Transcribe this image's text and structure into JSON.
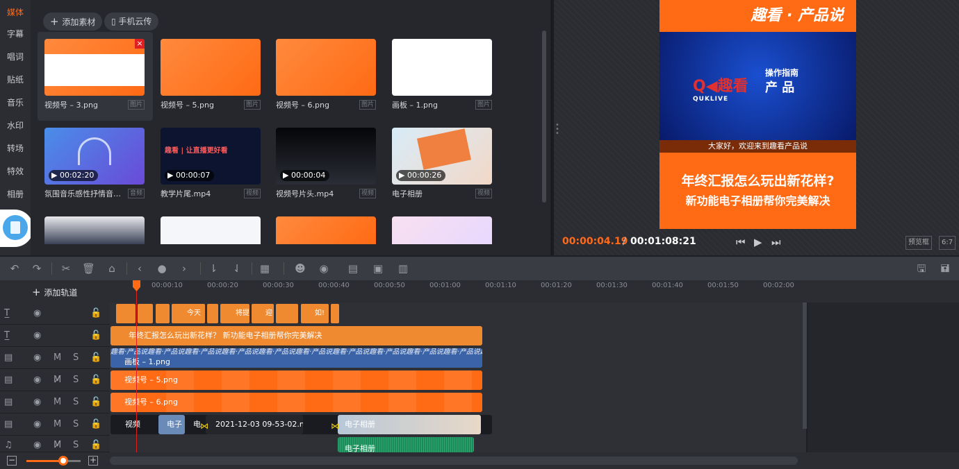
{
  "nav": [
    "媒体",
    "字幕",
    "唱词",
    "贴纸",
    "音乐",
    "水印",
    "转场",
    "特效",
    "相册"
  ],
  "media": {
    "add_label": "添加素材",
    "phone_label": "手机云传",
    "cards": [
      {
        "name": "视频号 – 3.png",
        "tag": "图片",
        "duration": ""
      },
      {
        "name": "视频号 – 5.png",
        "tag": "图片",
        "duration": ""
      },
      {
        "name": "视频号 – 6.png",
        "tag": "图片",
        "duration": ""
      },
      {
        "name": "画板 – 1.png",
        "tag": "图片",
        "duration": ""
      },
      {
        "name": "氛围音乐感性抒情音乐...",
        "tag": "音频",
        "duration": "00:02:20"
      },
      {
        "name": "教学片尾.mp4",
        "tag": "视频",
        "duration": "00:00:07"
      },
      {
        "name": "视频号片头.mp4",
        "tag": "视频",
        "duration": "00:00:04"
      },
      {
        "name": "电子相册",
        "tag": "视频",
        "duration": "00:00:26"
      }
    ],
    "thumb5_text": "趣看 | 让直播更好看"
  },
  "preview": {
    "banner": "趣看 · 产品说",
    "brand": "Q◀趣看",
    "brand_en": "QUKLIVE",
    "guide": "操作指南",
    "product": "产 品",
    "subtitle": "大家好，欢迎来到趣看产品说",
    "title1": "年终汇报怎么玩出新花样?",
    "title2": "新功能电子相册帮你完美解决",
    "time_current": "00:00:04.19",
    "time_sep": "/",
    "time_total": "00:01:08:21",
    "btn_frame": "预览框",
    "btn_ratio": "6:7"
  },
  "timeline": {
    "add_track": "添加轨道",
    "ticks": [
      "00:00:10",
      "00:00:20",
      "00:00:30",
      "00:00:40",
      "00:00:50",
      "00:01:00",
      "00:01:10",
      "00:01:20",
      "00:01:30",
      "00:01:40",
      "00:01:50",
      "00:02:00"
    ],
    "mini_clips": [
      "",
      "",
      "",
      "今天",
      "",
      "将提",
      "迎",
      "",
      "如!"
    ],
    "subtitle_clip": "年终汇报怎么玩出新花样？ 新功能电子相册帮你完美解决",
    "blue_clip_pattern": "趣看·产品说趣看·产品说趣看·产品说趣看·产品说趣看·产品说趣看·产品说趣看·产品说趣看·产品说趣看·产品说趣看·产品说趣看·产品说趣看·产品说",
    "blue_clip_label": "画板 – 1.png",
    "clip5": "视频号 – 5.png",
    "clip6": "视频号 – 6.png",
    "video_labels": [
      "视频",
      "电子",
      "电",
      "2021-12-03 09-53-02.n",
      "电子相册"
    ],
    "audio_clip": "电子相册"
  }
}
